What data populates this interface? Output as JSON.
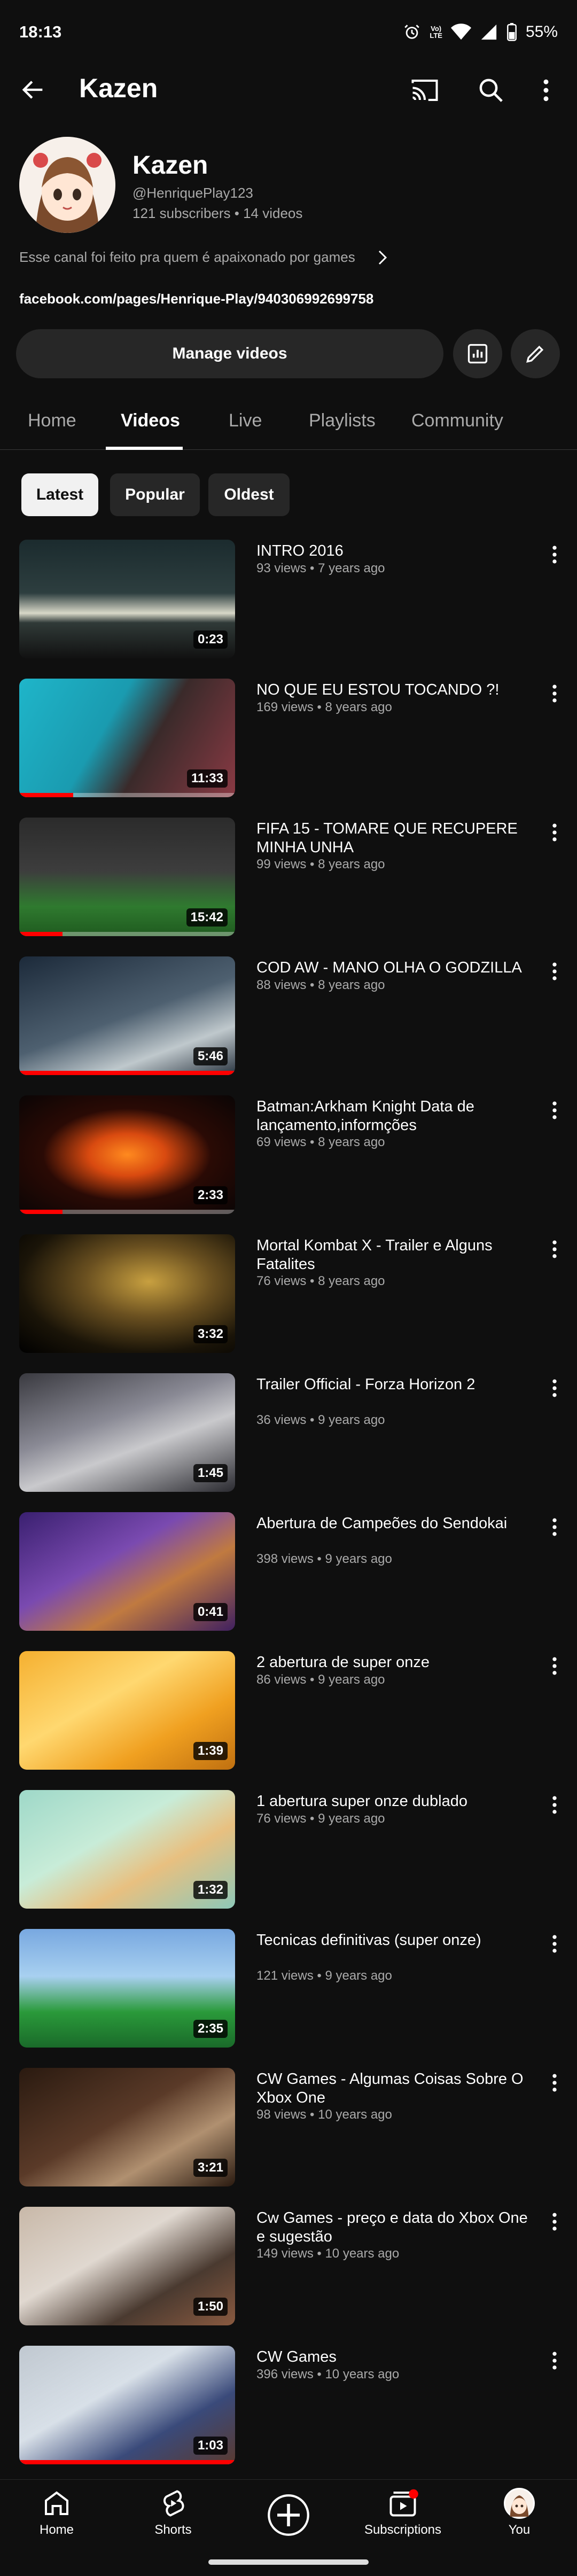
{
  "status_bar": {
    "time": "18:13",
    "network_top": "Vo)",
    "network_mid": "LTE",
    "battery": "55%"
  },
  "app_bar": {
    "title": "Kazen",
    "icons": [
      "back-arrow-icon",
      "cast-icon",
      "search-icon",
      "more-vert-icon"
    ]
  },
  "channel": {
    "name": "Kazen",
    "handle": "@HenriquePlay123",
    "meta": "121 subscribers • 14 videos",
    "description": "Esse canal foi feito pra quem é apaixonado por games",
    "link": "facebook.com/pages/Henrique-Play/940306992699758",
    "manage_label": "Manage videos"
  },
  "tabs": [
    "Home",
    "Videos",
    "Live",
    "Playlists",
    "Community"
  ],
  "active_tab": "Videos",
  "chips": [
    "Latest",
    "Popular",
    "Oldest"
  ],
  "active_chip": "Latest",
  "videos": [
    {
      "title": "INTRO 2016",
      "meta": "93 views • 7 years ago",
      "duration": "0:23",
      "progress": 0
    },
    {
      "title": "NO QUE EU ESTOU TOCANDO ?!",
      "meta": "169 views • 8 years ago",
      "duration": "11:33",
      "progress": 0.25
    },
    {
      "title": "FIFA 15 - TOMARE QUE RECUPERE MINHA UNHA",
      "meta": "99 views • 8 years ago",
      "duration": "15:42",
      "progress": 0.2
    },
    {
      "title": "COD AW - MANO OLHA O GODZILLA",
      "meta": "88 views • 8 years ago",
      "duration": "5:46",
      "progress": 1.0
    },
    {
      "title": "Batman:Arkham Knight Data de lançamento,informções",
      "meta": "69 views • 8 years ago",
      "duration": "2:33",
      "progress": 0.2
    },
    {
      "title": "Mortal Kombat X - Trailer e Alguns Fatalites",
      "meta": "76 views • 8 years ago",
      "duration": "3:32",
      "progress": 0
    },
    {
      "title": "Trailer Official - Forza Horizon 2",
      "meta": "36 views • 9 years ago",
      "duration": "1:45",
      "progress": 0
    },
    {
      "title": "Abertura de Campeões do Sendokai",
      "meta": "398 views • 9 years ago",
      "duration": "0:41",
      "progress": 0
    },
    {
      "title": "2 abertura de super onze",
      "meta": "86 views • 9 years ago",
      "duration": "1:39",
      "progress": 0
    },
    {
      "title": "1 abertura super onze dublado",
      "meta": "76 views • 9 years ago",
      "duration": "1:32",
      "progress": 0
    },
    {
      "title": "Tecnicas definitivas (super onze)",
      "meta": "121 views • 9 years ago",
      "duration": "2:35",
      "progress": 0
    },
    {
      "title": "CW Games - Algumas Coisas Sobre O Xbox One",
      "meta": "98 views • 10 years ago",
      "duration": "3:21",
      "progress": 0
    },
    {
      "title": "Cw Games - preço e data do Xbox One e sugestão",
      "meta": "149 views • 10 years ago",
      "duration": "1:50",
      "progress": 0
    },
    {
      "title": "CW  Games",
      "meta": "396 views • 10 years ago",
      "duration": "1:03",
      "progress": 1.0
    }
  ],
  "bottom_nav": [
    {
      "label": "Home",
      "icon": "home-icon"
    },
    {
      "label": "Shorts",
      "icon": "shorts-icon"
    },
    {
      "label": "",
      "icon": "create-plus-icon"
    },
    {
      "label": "Subscriptions",
      "icon": "subscriptions-icon"
    },
    {
      "label": "You",
      "icon": "you-avatar-icon"
    }
  ],
  "colors": {
    "background": "#0f0f0f",
    "chip": "#272727",
    "accent_red": "#ff0000",
    "secondary_text": "#aaaaaa"
  }
}
